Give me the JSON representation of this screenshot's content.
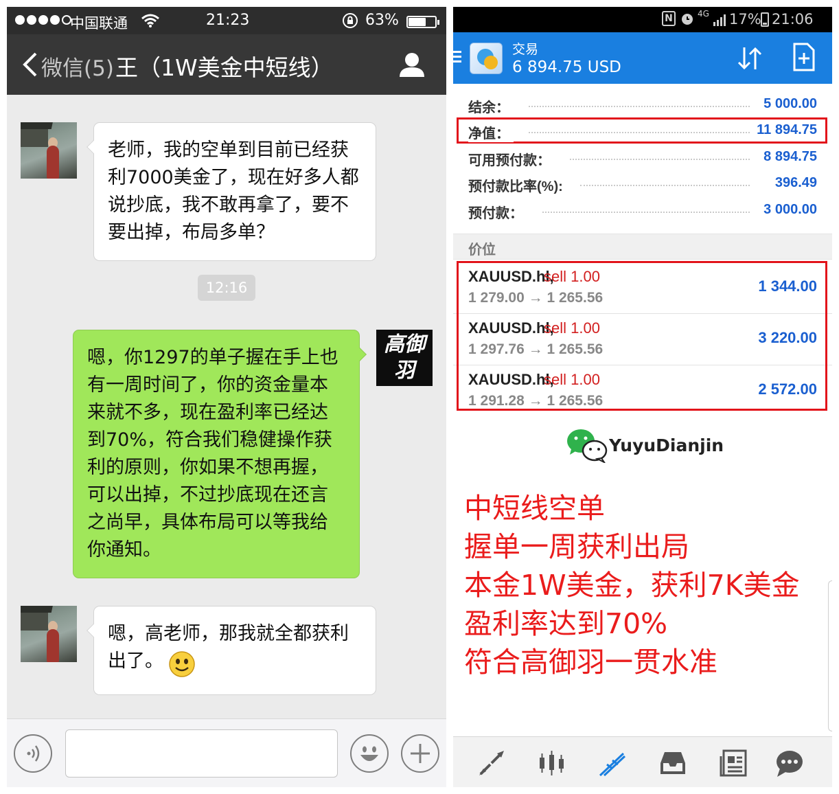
{
  "wechat": {
    "status": {
      "carrier": "中国联通",
      "time": "21:23",
      "battery": "63%",
      "battery_level": 0.63
    },
    "nav": {
      "back_label": "微信(5)",
      "title": "王（1W美金中短线）"
    },
    "messages": [
      {
        "from": "peer",
        "text": "老师，我的空单到目前已经获利7000美金了，现在好多人都说抄底，我不敢再拿了，要不要出掉，布局多单？"
      },
      {
        "from": "me",
        "text": "嗯，你1297的单子握在手上也有一周时间了，你的资金量本来就不多，现在盈利率已经达到70%，符合我们稳健操作获利的原则，你如果不想再握，可以出掉，不过抄底现在还言之尚早，具体布局可以等我给你通知。"
      },
      {
        "from": "peer",
        "text": "嗯，高老师，那我就全都获利出了。"
      }
    ],
    "timestamp": "12:16",
    "stamp_text": "高御羽"
  },
  "mt4": {
    "status": {
      "network": "4G",
      "battery": "17%",
      "battery_level": 0.17,
      "time": "21:06"
    },
    "header": {
      "title": "交易",
      "balance": "6 894.75 USD"
    },
    "account": [
      {
        "label": "结余：",
        "value": "5 000.00"
      },
      {
        "label": "净值：",
        "value": "11 894.75"
      },
      {
        "label": "可用预付款：",
        "value": "8 894.75"
      },
      {
        "label": "预付款比率(%):",
        "value": "396.49"
      },
      {
        "label": "预付款：",
        "value": "3 000.00"
      }
    ],
    "section_label": "价位",
    "positions": [
      {
        "symbol": "XAUUSD.hl,",
        "side": "sell 1.00",
        "open": "1 279.00",
        "current": "1 265.56",
        "profit": "1 344.00"
      },
      {
        "symbol": "XAUUSD.hl,",
        "side": "sell 1.00",
        "open": "1 297.76",
        "current": "1 265.56",
        "profit": "3 220.00"
      },
      {
        "symbol": "XAUUSD.hl,",
        "side": "sell 1.00",
        "open": "1 291.28",
        "current": "1 265.56",
        "profit": "2 572.00"
      }
    ],
    "arrow": "→",
    "brand": "YuyuDianjin",
    "annotation": [
      "中短线空单",
      "握单一周获利出局",
      "本金1W美金，获利7K美金",
      "盈利率达到70%",
      "符合高御羽一贯水准"
    ],
    "tabs": [
      "quotes-tab",
      "chart-tab",
      "trade-tab",
      "history-tab",
      "news-tab",
      "chat-tab"
    ],
    "colors": {
      "header_blue": "#1a7fe0",
      "value_blue": "#1a5fd0",
      "sell_red": "#d21f1f",
      "highlight_red": "#e2141b",
      "wechat_green": "#a0e75a"
    }
  }
}
